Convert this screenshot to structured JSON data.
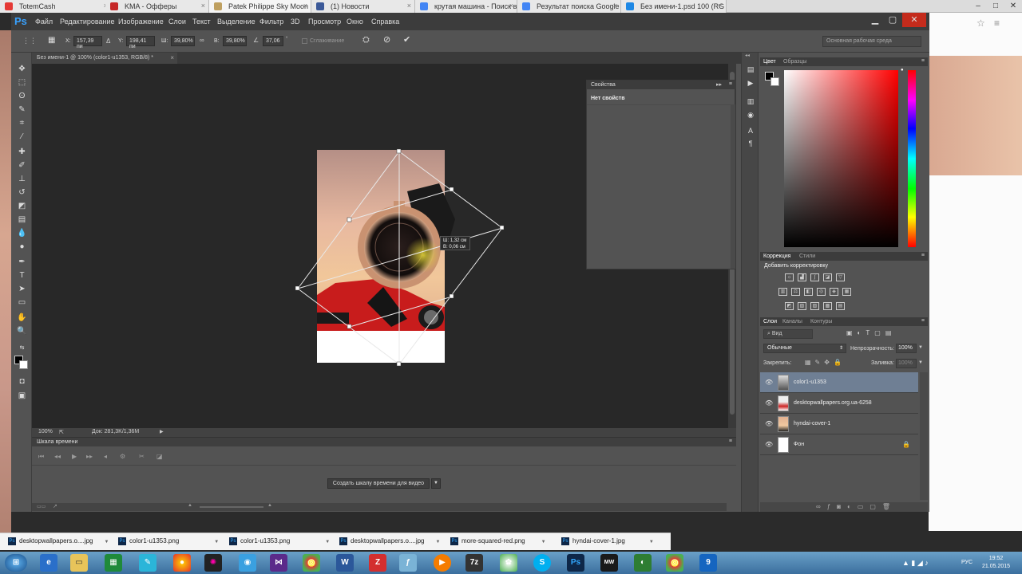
{
  "browser": {
    "tabs": [
      {
        "label": "TotemCash",
        "color": "#e53935"
      },
      {
        "label": "KMA - Офферы",
        "color": "#c62828"
      },
      {
        "label": "Patek Philippe Sky Moon",
        "color": "#bfa060"
      },
      {
        "label": "(1) Новости",
        "color": "#3b5998"
      },
      {
        "label": "крутая машина - Поиск в",
        "color": "#4285f4"
      },
      {
        "label": "Результат поиска Google",
        "color": "#4285f4"
      },
      {
        "label": "Без имени-1.psd 100 (RG",
        "color": "#1e88e5"
      }
    ]
  },
  "ps": {
    "logo": "Ps",
    "menu": [
      "Файл",
      "Редактирование",
      "Изображение",
      "Слои",
      "Текст",
      "Выделение",
      "Фильтр",
      "3D",
      "Просмотр",
      "Окно",
      "Справка"
    ],
    "options": {
      "x_label": "X:",
      "x_value": "157,39 пи",
      "y_label": "Y:",
      "y_value": "198,41 пи",
      "w_label": "Ш:",
      "w_value": "39,80%",
      "h_label": "В:",
      "h_value": "39,80%",
      "angle_value": "37,06",
      "antialias_label": "Сглаживание",
      "workspace": "Основная рабочая среда"
    },
    "doc_tab": "Без имени-1 @ 100% (color1-u1353, RGB/8) *",
    "transform_tooltip": {
      "w": "Ш: 1,32 см",
      "h": "В: 0,06 см"
    },
    "status": {
      "zoom": "100%",
      "doc": "Док: 281,3K/1,36M"
    },
    "timeline": {
      "title": "Шкала времени",
      "create_button": "Создать шкалу времени для видео"
    },
    "properties": {
      "title": "Свойства",
      "empty": "Нет свойств"
    },
    "color_panel": {
      "tab_color": "Цвет",
      "tab_swatches": "Образцы"
    },
    "adjust_panel": {
      "tab_correction": "Коррекция",
      "tab_styles": "Стили",
      "add_label": "Добавить корректировку"
    },
    "layers_panel": {
      "tab_layers": "Слои",
      "tab_channels": "Каналы",
      "tab_paths": "Контуры",
      "kind": "Вид",
      "blend_mode": "Обычные",
      "opacity_label": "Непрозрачность:",
      "opacity_value": "100%",
      "lock_label": "Закрепить:",
      "fill_label": "Заливка:",
      "fill_value": "100%",
      "layers": [
        {
          "name": "color1-u1353",
          "selected": true
        },
        {
          "name": "desktopwallpapers.org.ua-6258",
          "selected": false
        },
        {
          "name": "hyndai-cover-1",
          "selected": false
        },
        {
          "name": "Фон",
          "selected": false
        }
      ]
    }
  },
  "downloads": [
    {
      "label": "desktopwallpapers.o....jpg"
    },
    {
      "label": "color1-u1353.png"
    },
    {
      "label": "color1-u1353.png"
    },
    {
      "label": "desktopwallpapers.o....jpg"
    },
    {
      "label": "more-squared-red.png"
    },
    {
      "label": "hyndai-cover-1.jpg"
    }
  ],
  "tray": {
    "lang": "РУС",
    "time": "19:52",
    "date": "21.05.2015"
  }
}
